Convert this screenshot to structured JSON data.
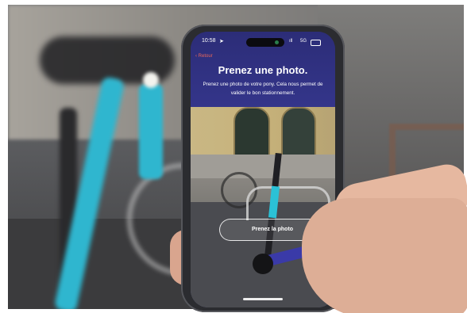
{
  "status_bar": {
    "time": "10:58",
    "nav_glyph": "➤",
    "signal": "ıll",
    "network": "5G"
  },
  "app": {
    "back_label": "‹ Retour",
    "title": "Prenez une photo.",
    "subtitle": "Prenez une photo de votre pony. Cela nous permet de valider le bon stationnement.",
    "cta_label": "Prenez la photo"
  },
  "icons": {
    "location": "location-arrow-icon",
    "battery": "battery-icon",
    "signal": "cellular-signal-icon"
  },
  "colors": {
    "app_header": "#2c2d78",
    "back_link": "#e9665a",
    "scooter_accent": "#2bc1d6"
  }
}
